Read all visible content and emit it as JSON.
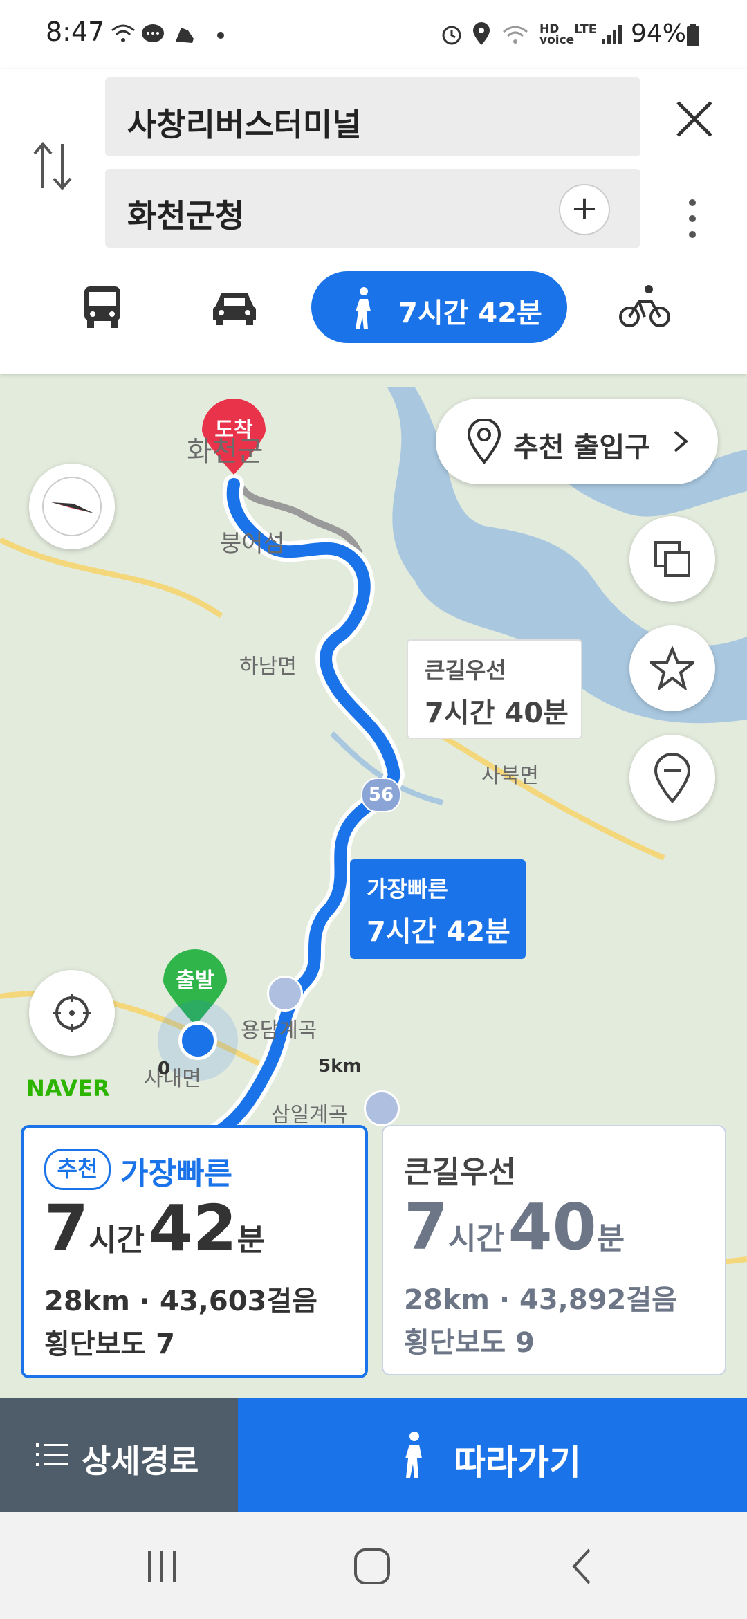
{
  "status_bar": {
    "time": "8:47",
    "battery": "94%"
  },
  "route": {
    "origin": "사창리버스터미널",
    "destination": "화천군청",
    "active_mode_time": "7시간 42분"
  },
  "map": {
    "recommended_entrance": "추천 출입구",
    "arrival_pin": "도착",
    "departure_pin": "출발",
    "callout_alt": {
      "title": "큰길우선",
      "time": "7시간 40분"
    },
    "callout_fast": {
      "title": "가장빠른",
      "time": "7시간 42분"
    },
    "labels": {
      "hwacheon": "화천군",
      "bungeoseom": "붕어섬",
      "haname": "하남면",
      "sabukmyeon": "사북면",
      "yongdam": "용담계곡",
      "samil": "삼일계곡",
      "sanaemyeon": "사내면",
      "road_no": "56"
    },
    "scale": {
      "zero": "0",
      "max": "5km"
    },
    "brand": "NAVER"
  },
  "cards": [
    {
      "badge": "추천",
      "name": "가장빠른",
      "hours": "7",
      "hours_unit": "시간",
      "minutes": "42",
      "minutes_unit": "분",
      "distance": "28km",
      "steps": "43,603걸음",
      "crosswalks": "횡단보도 7"
    },
    {
      "name": "큰길우선",
      "hours": "7",
      "hours_unit": "시간",
      "minutes": "40",
      "minutes_unit": "분",
      "distance": "28km",
      "steps": "43,892걸음",
      "crosswalks": "횡단보도 9"
    }
  ],
  "bottom": {
    "detail_label": "상세경로",
    "follow_label": "따라가기"
  },
  "colors": {
    "accent": "#1a73e8",
    "arrival": "#e8334a",
    "departure": "#2fb54a",
    "map_bg": "#e3ebdd"
  }
}
